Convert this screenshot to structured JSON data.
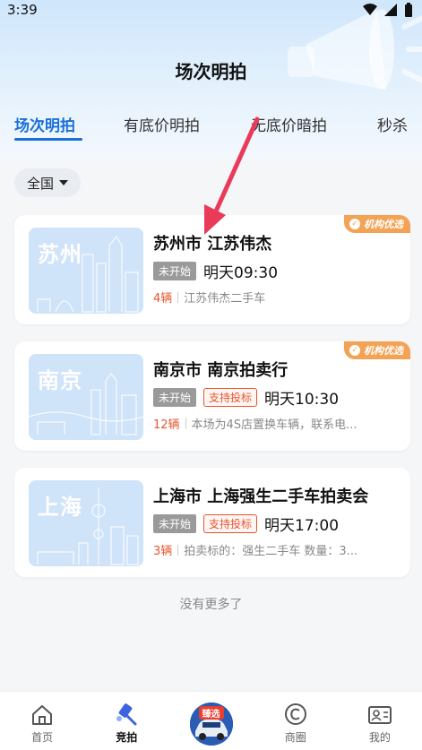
{
  "status_bar": {
    "time": "3:39"
  },
  "header": {
    "title": "场次明拍"
  },
  "tabs": [
    {
      "label": "场次明拍",
      "active": true
    },
    {
      "label": "有底价明拍",
      "active": false
    },
    {
      "label": "无底价暗拍",
      "active": false
    },
    {
      "label": "秒杀",
      "active": false
    }
  ],
  "filter": {
    "label": "全国"
  },
  "cards": [
    {
      "thumb_city": "苏州",
      "title": "苏州市 江苏伟杰",
      "status": "未开始",
      "tender_badge": "",
      "time": "明天09:30",
      "count": "4辆",
      "desc": "江苏伟杰二手车",
      "corner_tag": "机构优选"
    },
    {
      "thumb_city": "南京",
      "title": "南京市 南京拍卖行",
      "status": "未开始",
      "tender_badge": "支持投标",
      "time": "明天10:30",
      "count": "12辆",
      "desc": "本场为4S店置换车辆，联系电...",
      "corner_tag": "机构优选"
    },
    {
      "thumb_city": "上海",
      "title": "上海市 上海强生二手车拍卖会",
      "status": "未开始",
      "tender_badge": "支持投标",
      "time": "明天17:00",
      "count": "3辆",
      "desc": "拍卖标的：强生二手车 数量：3...",
      "corner_tag": ""
    }
  ],
  "footer_text": "没有更多了",
  "bottom_nav": {
    "home": "首页",
    "auction": "竞拍",
    "center_badge": "臻选",
    "business": "商圈",
    "mine": "我的"
  },
  "colors": {
    "accent": "#1a6fd8",
    "orange": "#e8542f",
    "tag": "#f3a356",
    "arrow": "#ea3a5a"
  }
}
